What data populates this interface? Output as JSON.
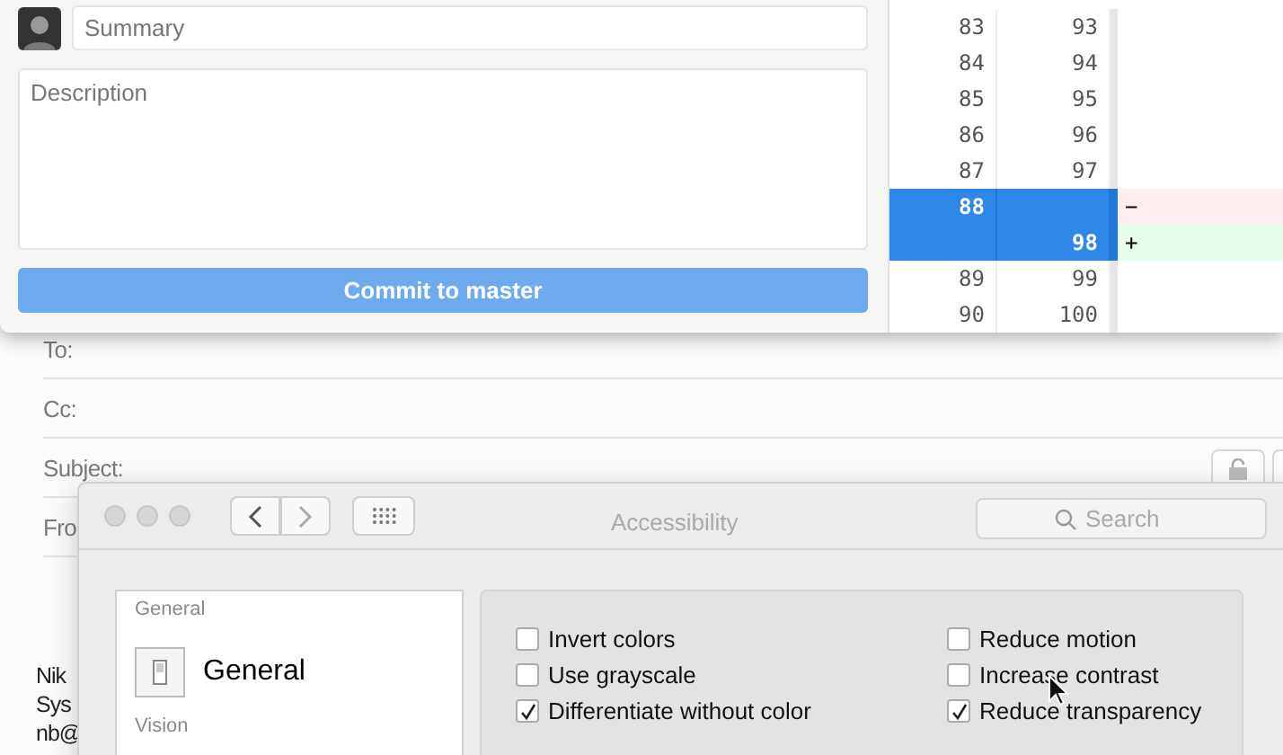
{
  "mail_window": {
    "fields": [
      {
        "label": "To:"
      },
      {
        "label": "Cc:"
      },
      {
        "label": "Subject:"
      },
      {
        "label": "Fro"
      }
    ],
    "signature": [
      "Nik",
      "Sys",
      "nb@"
    ]
  },
  "commit_window": {
    "summary": {
      "placeholder": "Summary"
    },
    "description": {
      "placeholder": "Description"
    },
    "commit_button": {
      "text": "Commit to **master**"
    },
    "diff_rows": [
      {
        "old": "83",
        "new": "93",
        "kind": "context",
        "selected": false,
        "marker": ""
      },
      {
        "old": "84",
        "new": "94",
        "kind": "context",
        "selected": false
      },
      {
        "old": "85",
        "new": "95",
        "kind": "context",
        "selected": false
      },
      {
        "old": "86",
        "new": "96",
        "kind": "context",
        "selected": false
      },
      {
        "old": "87",
        "new": "97",
        "kind": "context",
        "selected": false
      },
      {
        "old": "88",
        "kind": "removed",
        "selected": true,
        "marker": "−"
      },
      {
        "new": "98",
        "kind": "added",
        "selected": true,
        "marker": "+"
      },
      {
        "old": "89",
        "new": "99",
        "kind": "context",
        "selected": false
      },
      {
        "old": "90",
        "new": "100",
        "kind": "context",
        "selected": false
      }
    ]
  },
  "prefs_window": {
    "title": "Accessibility",
    "search": {
      "placeholder": "Search"
    },
    "sidebar": [
      {
        "kind": "header",
        "label": "General"
      },
      {
        "kind": "item",
        "label": "General",
        "selected": false
      },
      {
        "kind": "header",
        "label": "Vision"
      }
    ],
    "options": [
      {
        "label": "Invert colors",
        "checked": false
      },
      {
        "label": "Reduce motion",
        "checked": false
      },
      {
        "label": "Use grayscale",
        "checked": false
      },
      {
        "label": "Increase contrast",
        "checked": false
      },
      {
        "label": "Differentiate without color",
        "checked": true
      },
      {
        "label": "Reduce transparency",
        "checked": true
      }
    ]
  }
}
